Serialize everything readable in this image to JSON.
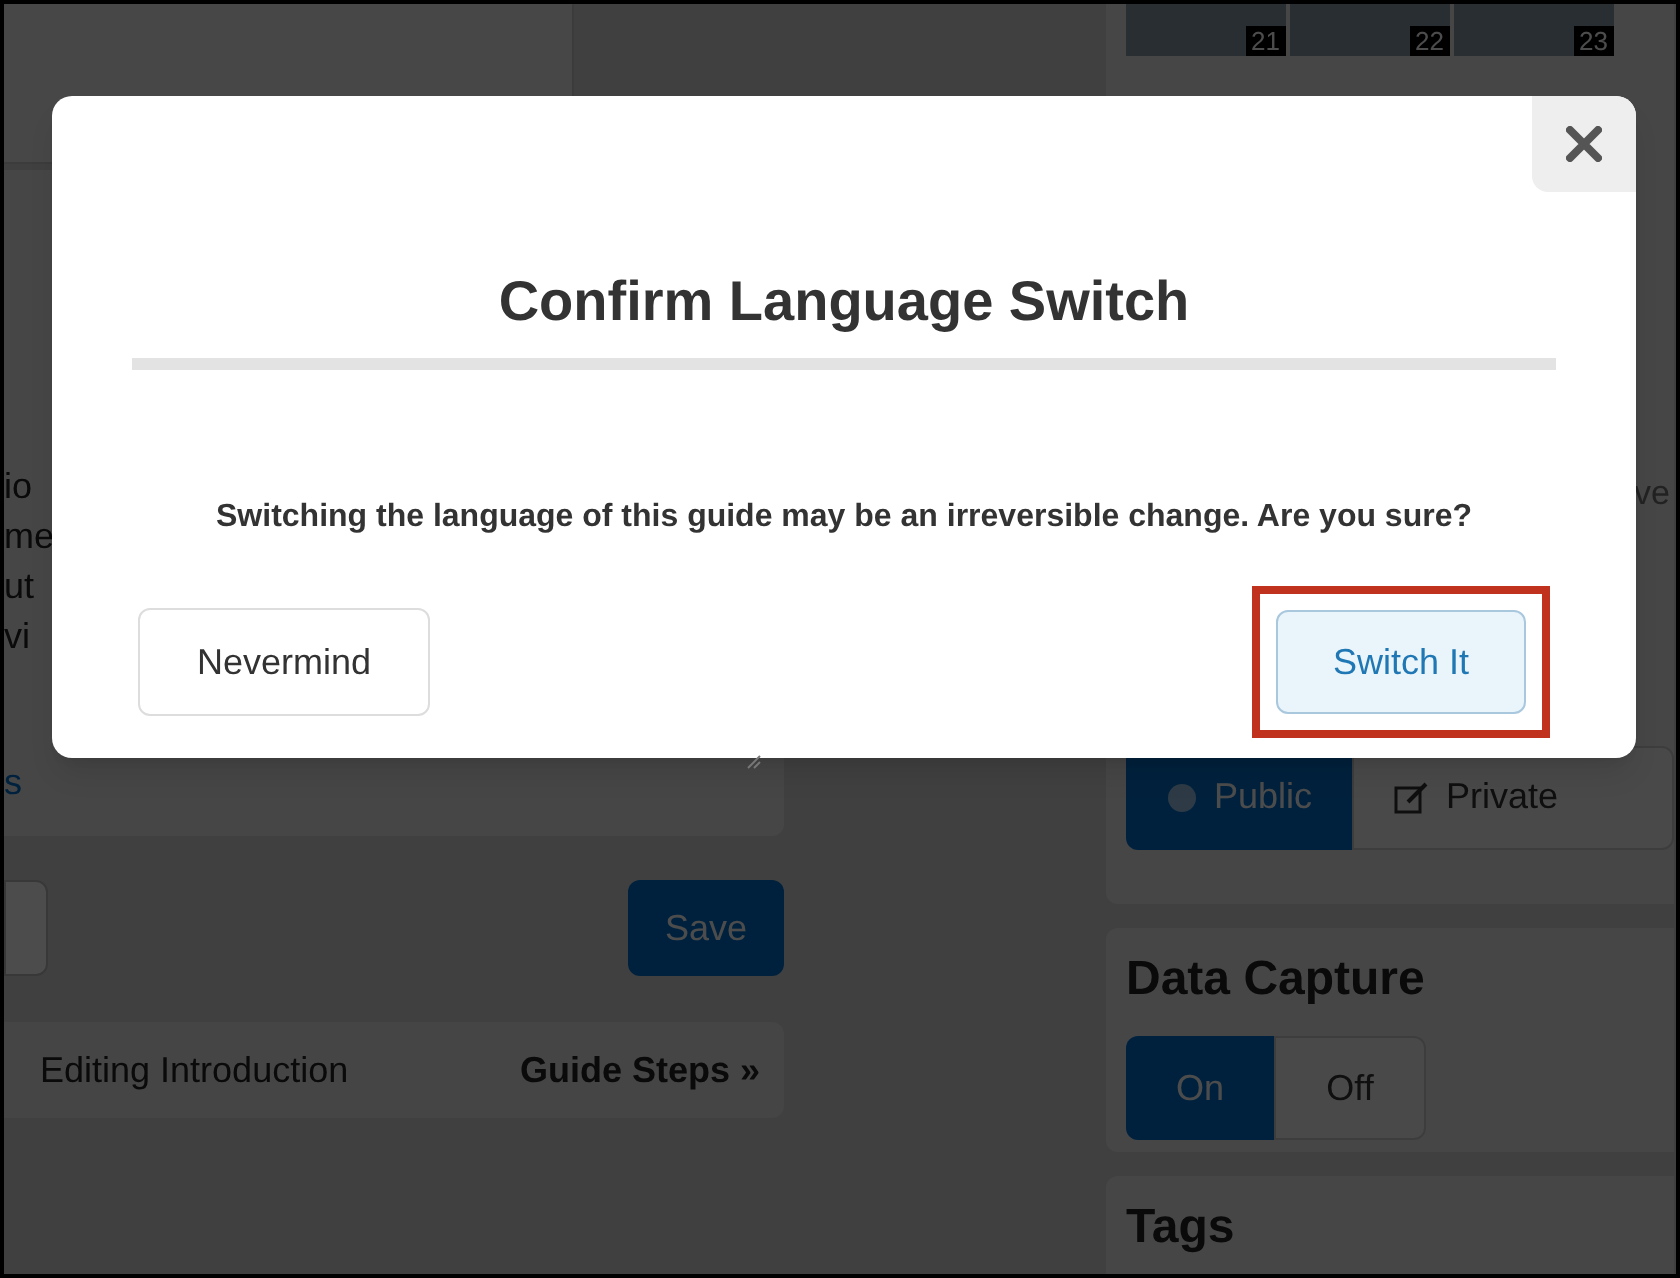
{
  "background": {
    "text_fragments": [
      "io",
      "me",
      "ut",
      "vi"
    ],
    "fragment_bottom": "s",
    "save_button": "Save",
    "nav": {
      "current": "Editing Introduction",
      "next": "Guide Steps »"
    },
    "thumbnails": [
      "21",
      "22",
      "23"
    ],
    "right_fragment": "ve",
    "visibility": [
      {
        "label": "Public",
        "selected": true
      },
      {
        "label": "Private",
        "selected": false
      }
    ],
    "data_capture": {
      "title": "Data Capture",
      "options": [
        {
          "label": "On",
          "selected": true
        },
        {
          "label": "Off",
          "selected": false
        }
      ]
    },
    "tags": {
      "title": "Tags"
    }
  },
  "dialog": {
    "title": "Confirm Language Switch",
    "message": "Switching the language of this guide may be an irreversible change. Are you sure?",
    "buttons": [
      {
        "label": "Nevermind",
        "kind": "cancel",
        "highlighted": false
      },
      {
        "label": "Switch It",
        "kind": "confirm",
        "highlighted": true
      }
    ]
  }
}
